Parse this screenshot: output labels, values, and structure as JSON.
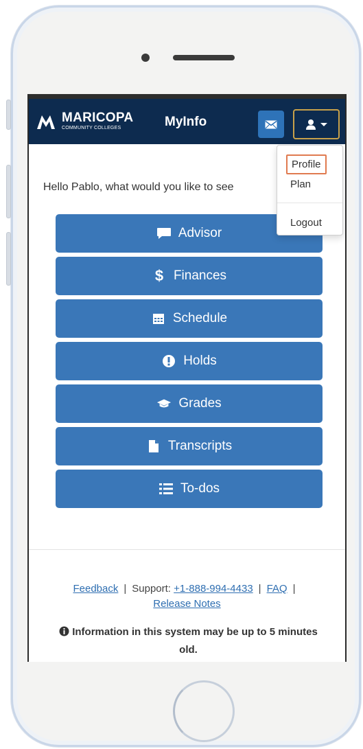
{
  "navbar": {
    "logo_name": "MARICOPA",
    "logo_sub": "COMMUNITY COLLEGES",
    "title": "MyInfo",
    "mail_icon": "envelope-icon",
    "user_icon": "user-icon"
  },
  "dropdown": {
    "items": [
      "Profile",
      "Plan",
      "Logout"
    ],
    "highlighted": "Profile"
  },
  "greeting": "Hello Pablo, what would you like to see",
  "menu": [
    {
      "label": "Advisor",
      "icon": "comment-icon"
    },
    {
      "label": "Finances",
      "icon": "dollar-icon"
    },
    {
      "label": "Schedule",
      "icon": "calendar-icon"
    },
    {
      "label": "Holds",
      "icon": "exclamation-icon"
    },
    {
      "label": "Grades",
      "icon": "graduation-cap-icon"
    },
    {
      "label": "Transcripts",
      "icon": "file-icon"
    },
    {
      "label": "To-dos",
      "icon": "list-icon"
    }
  ],
  "footer": {
    "feedback": "Feedback",
    "support_label": "Support:",
    "phone": "+1-888-994-4433",
    "faq": "FAQ",
    "release_notes": "Release Notes",
    "info": "Information in this system may be up to 5 minutes old."
  },
  "colors": {
    "navbar": "#0d2b4f",
    "button": "#3a77b8",
    "mail_button": "#2e73b8",
    "user_border": "#c8a14a",
    "highlight": "#e07a4f"
  }
}
